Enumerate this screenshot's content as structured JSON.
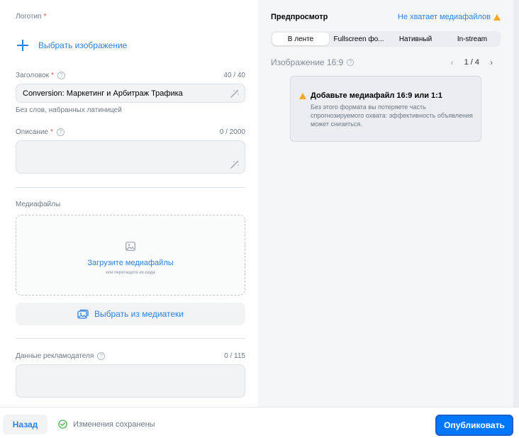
{
  "form": {
    "logo": {
      "label": "Логотип",
      "required_mark": "*",
      "pick_label": "Выбрать изображение",
      "icon": "plus-icon"
    },
    "headline": {
      "label": "Заголовок",
      "required_mark": "*",
      "counter": "40 / 40",
      "value": "Conversion: Маркетинг и Арбитраж Трафика",
      "hint": "Без слов, набранных латиницей"
    },
    "description": {
      "label": "Описание",
      "required_mark": "*",
      "counter": "0 / 2000",
      "value": ""
    },
    "media": {
      "label": "Медиафайлы",
      "upload_label": "Загрузите медиафайлы",
      "drag_hint": "или перетащите их сюда",
      "library_label": "Выбрать из медиатеки"
    },
    "advertiser": {
      "label": "Данные рекламодателя",
      "counter": "0 / 115",
      "value": ""
    }
  },
  "preview": {
    "title": "Предпросмотр",
    "warning_link": "Не хватает медиафайлов",
    "tabs": [
      {
        "label": "В ленте",
        "active": true
      },
      {
        "label": "Fullscreen фо...",
        "active": false
      },
      {
        "label": "Нативный",
        "active": false
      },
      {
        "label": "In-stream",
        "active": false
      }
    ],
    "format_label": "Изображение 16:9",
    "pager": "1 / 4",
    "notice": {
      "title": "Добавьте медиафайл 16:9 или 1:1",
      "body": "Без этого формата вы потеряете часть спрогнозируемого охвата: эффективность объявления может снизиться."
    }
  },
  "footer": {
    "back_label": "Назад",
    "saved_label": "Изменения сохранены",
    "publish_label": "Опубликовать"
  },
  "colors": {
    "accent": "#2d81e0",
    "primary_button": "#0077ff",
    "warning": "#f5a623",
    "required": "#e64646",
    "success": "#4bb34b"
  }
}
